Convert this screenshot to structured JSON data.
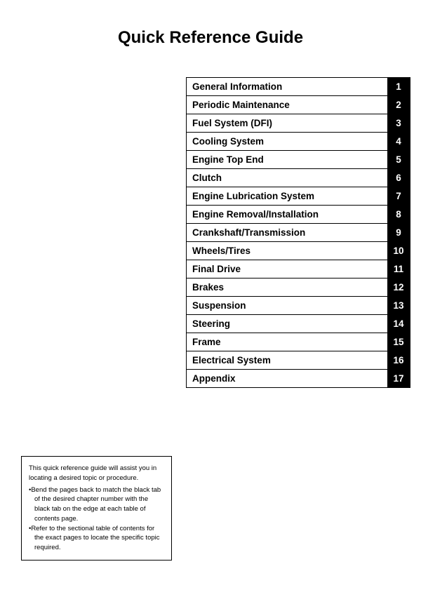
{
  "title": "Quick Reference Guide",
  "toc": {
    "items": [
      {
        "label": "General Information",
        "number": "1"
      },
      {
        "label": "Periodic Maintenance",
        "number": "2"
      },
      {
        "label": "Fuel System (DFI)",
        "number": "3"
      },
      {
        "label": "Cooling System",
        "number": "4"
      },
      {
        "label": "Engine Top End",
        "number": "5"
      },
      {
        "label": "Clutch",
        "number": "6"
      },
      {
        "label": "Engine Lubrication System",
        "number": "7"
      },
      {
        "label": "Engine Removal/Installation",
        "number": "8"
      },
      {
        "label": "Crankshaft/Transmission",
        "number": "9"
      },
      {
        "label": "Wheels/Tires",
        "number": "10"
      },
      {
        "label": "Final Drive",
        "number": "11"
      },
      {
        "label": "Brakes",
        "number": "12"
      },
      {
        "label": "Suspension",
        "number": "13"
      },
      {
        "label": "Steering",
        "number": "14"
      },
      {
        "label": "Frame",
        "number": "15"
      },
      {
        "label": "Electrical System",
        "number": "16"
      },
      {
        "label": "Appendix",
        "number": "17"
      }
    ]
  },
  "info_box": {
    "intro": "This quick reference guide will assist you in locating a desired topic or procedure.",
    "bullet1": "Bend the pages back to match the black tab of the desired chapter number with the black tab on the edge at each table of contents page.",
    "bullet2": "Refer to the sectional table of contents for the exact pages to locate the specific topic required."
  }
}
